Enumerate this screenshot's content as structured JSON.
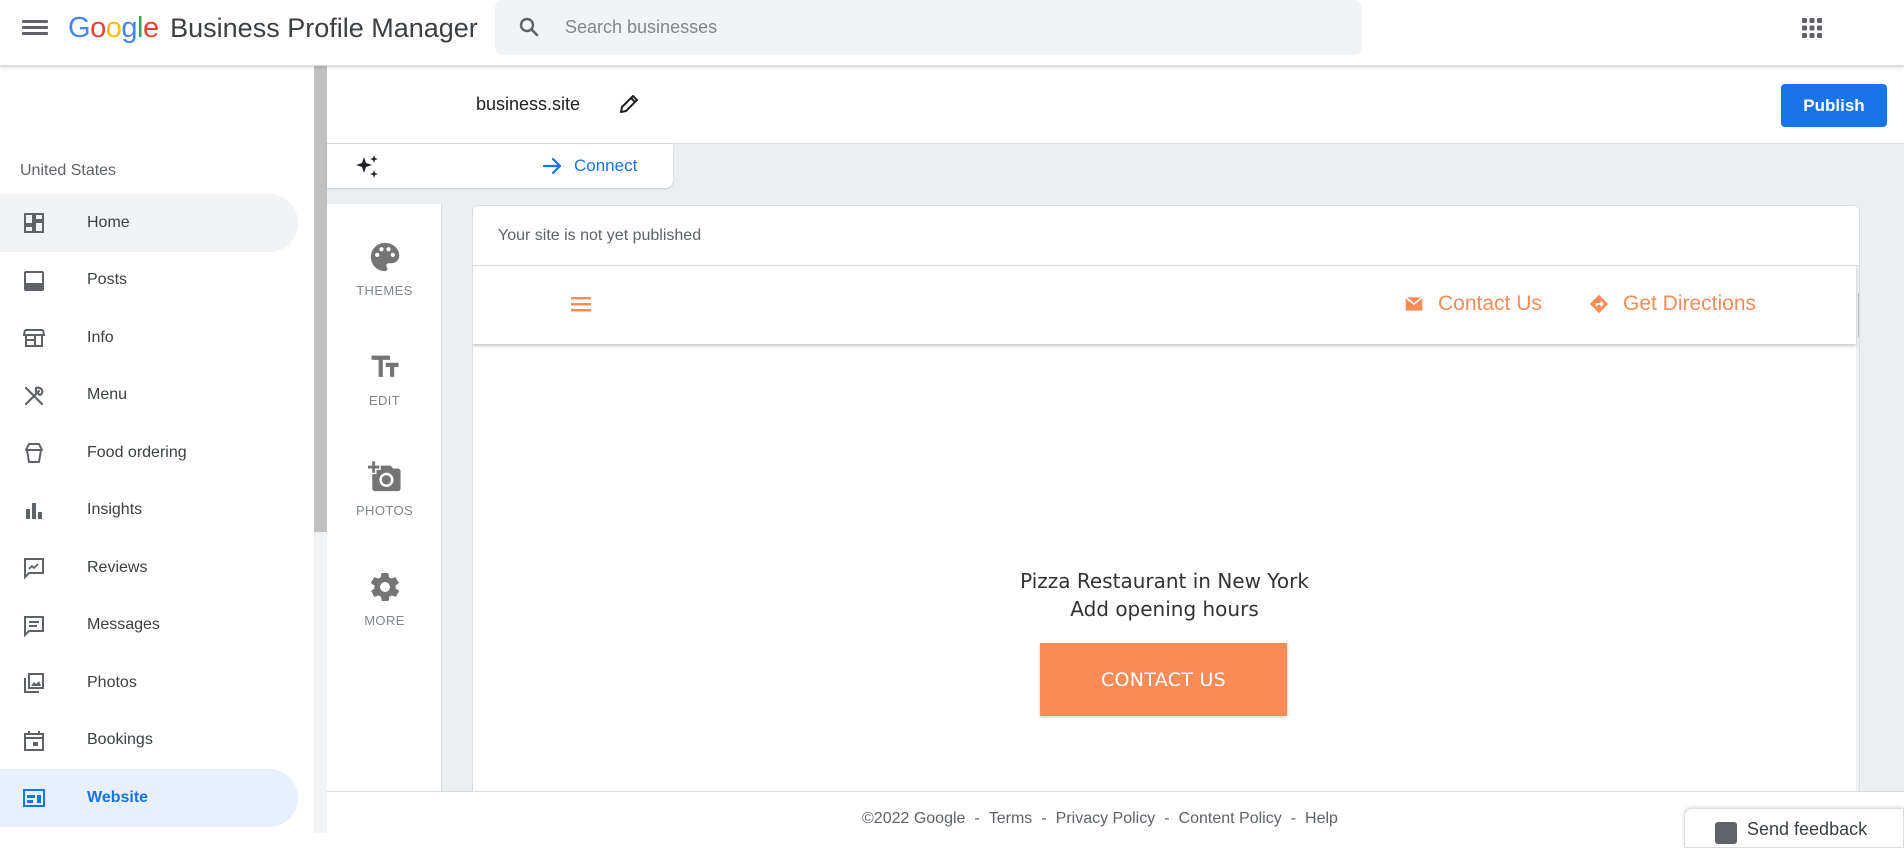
{
  "header": {
    "logo_letters": [
      "G",
      "o",
      "o",
      "g",
      "l",
      "e"
    ],
    "product_name": "Business Profile Manager",
    "search_placeholder": "Search businesses"
  },
  "sidebar": {
    "country": "United States",
    "items": [
      {
        "label": "Home",
        "icon": "dashboard-icon"
      },
      {
        "label": "Posts",
        "icon": "posts-icon"
      },
      {
        "label": "Info",
        "icon": "storefront-icon"
      },
      {
        "label": "Menu",
        "icon": "restaurant-icon"
      },
      {
        "label": "Food ordering",
        "icon": "takeout-icon"
      },
      {
        "label": "Insights",
        "icon": "bar-chart-icon"
      },
      {
        "label": "Reviews",
        "icon": "rate-review-icon"
      },
      {
        "label": "Messages",
        "icon": "message-icon"
      },
      {
        "label": "Photos",
        "icon": "photo-library-icon"
      },
      {
        "label": "Bookings",
        "icon": "calendar-icon"
      },
      {
        "label": "Website",
        "icon": "website-icon",
        "active": true
      }
    ]
  },
  "site": {
    "domain": "business.site",
    "publish_label": "Publish",
    "connect_label": "Connect",
    "status_text": "Your site is not yet published"
  },
  "tools": [
    {
      "label": "THEMES",
      "icon": "palette-icon"
    },
    {
      "label": "EDIT",
      "icon": "text-fields-icon"
    },
    {
      "label": "PHOTOS",
      "icon": "add-a-photo-icon"
    },
    {
      "label": "MORE",
      "icon": "settings-icon"
    }
  ],
  "preview": {
    "nav_contact": "Contact Us",
    "nav_directions": "Get Directions",
    "hero_line1": "Pizza Restaurant in New York",
    "hero_line2": "Add opening hours",
    "cta_label": "CONTACT US",
    "accent_color": "#f98b56"
  },
  "footer": {
    "copyright": "©2022 Google",
    "links": [
      "Terms",
      "Privacy Policy",
      "Content Policy",
      "Help"
    ],
    "separator": "-",
    "feedback_label": "Send feedback"
  },
  "colors": {
    "primary_blue": "#1a73e8",
    "active_bg": "#e8f0fe",
    "page_bg": "#eceff1"
  }
}
